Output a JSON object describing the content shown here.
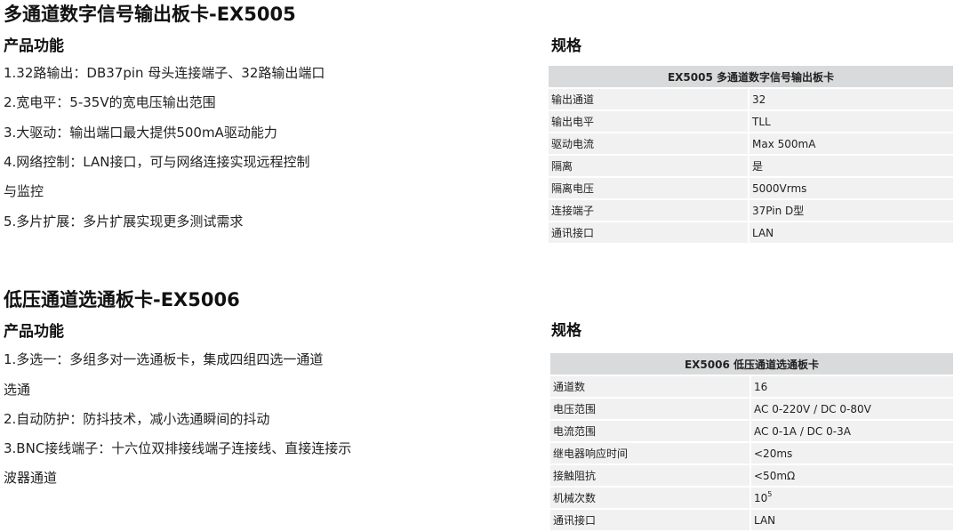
{
  "s1": {
    "title": "多通道数字信号输出板卡-EX5005",
    "features_heading": "产品功能",
    "features": [
      "1.32路输出：DB37pin 母头连接端子、32路输出端口",
      "2.宽电平：5-35V的宽电压输出范围",
      "3.大驱动：输出端口最大提供500mA驱动能力",
      "4.网络控制：LAN接口，可与网络连接实现远程控制",
      "与监控",
      "5.多片扩展：多片扩展实现更多测试需求"
    ],
    "spec_heading": "规格",
    "table_header": "EX5005  多通道数字信号输出板卡",
    "rows": [
      {
        "k": "输出通道",
        "v": "32"
      },
      {
        "k": "输出电平",
        "v": "TLL"
      },
      {
        "k": "驱动电流",
        "v": "Max 500mA"
      },
      {
        "k": "隔离",
        "v": "是"
      },
      {
        "k": "隔离电压",
        "v": "5000Vrms"
      },
      {
        "k": "连接端子",
        "v": "37Pin D型"
      },
      {
        "k": "通讯接口",
        "v": "LAN"
      }
    ]
  },
  "s2": {
    "title": "低压通道选通板卡-EX5006",
    "features_heading": "产品功能",
    "features": [
      "1.多选一：多组多对一选通板卡，集成四组四选一通道",
      "选通",
      "2.自动防护：防抖技术，减小选通瞬间的抖动",
      "3.BNC接线端子：十六位双排接线端子连接线、直接连接示",
      "波器通道"
    ],
    "spec_heading": "规格",
    "table_header": "EX5006 低压通道选通板卡",
    "rows": [
      {
        "k": "通道数",
        "v": "16"
      },
      {
        "k": "电压范围",
        "v": "AC 0-220V / DC 0-80V"
      },
      {
        "k": "电流范围",
        "v": "AC 0-1A / DC 0-3A"
      },
      {
        "k": "继电器响应时间",
        "v": "<20ms"
      },
      {
        "k": "接触阻抗",
        "v": "<50mΩ"
      },
      {
        "k": "机械次数",
        "v": "10",
        "sup": "5"
      },
      {
        "k": "通讯接口",
        "v": "LAN"
      }
    ]
  }
}
